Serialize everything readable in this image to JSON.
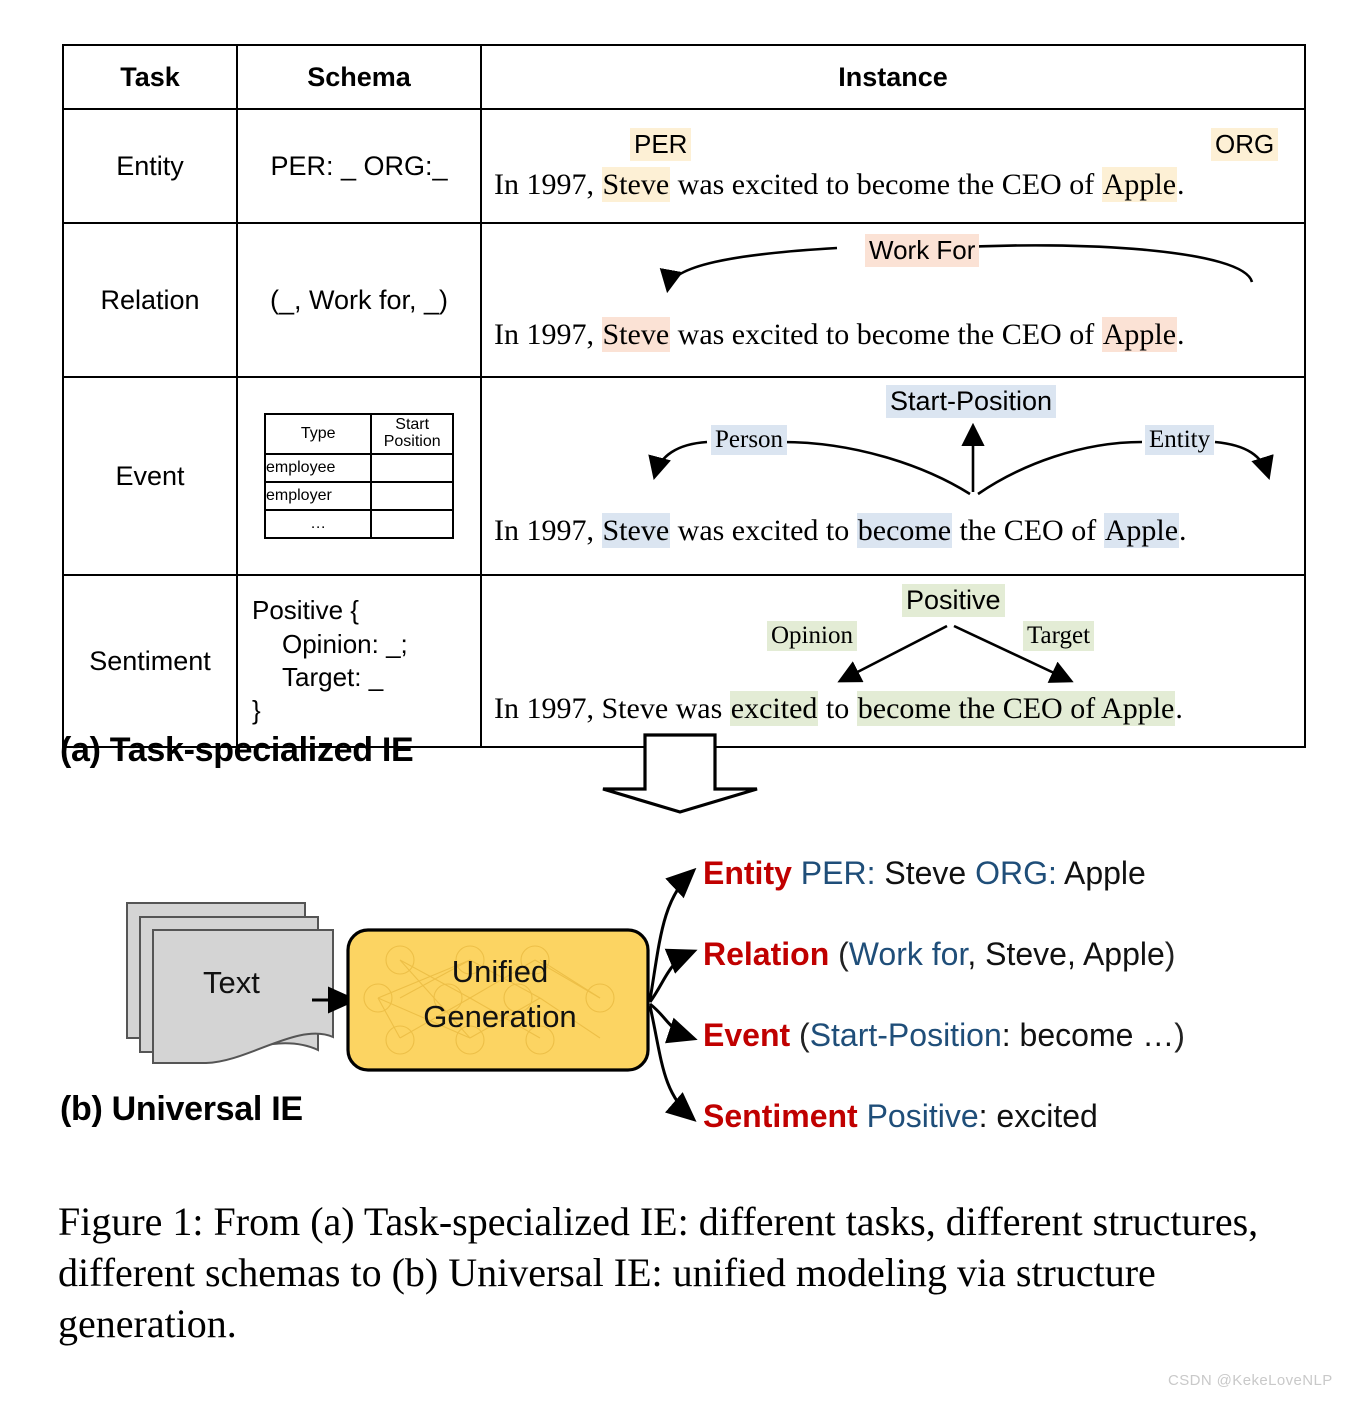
{
  "table": {
    "headers": [
      "Task",
      "Schema",
      "Instance"
    ],
    "rows": [
      {
        "task": "Entity",
        "schema": "PER: _ ORG:_",
        "sentence_prefix": "In 1997, ",
        "parts": [
          "In 1997, ",
          "Steve",
          " was excited to become the CEO of ",
          "Apple",
          "."
        ],
        "labels": [
          "PER",
          "ORG"
        ],
        "highlight_color": "#fdf0d5"
      },
      {
        "task": "Relation",
        "schema": "(_, Work for, _)",
        "parts": [
          "In 1997, ",
          "Steve",
          " was excited to become the CEO of ",
          "Apple",
          "."
        ],
        "labels": [
          "Work For"
        ],
        "highlight_color": "#fbe2d5"
      },
      {
        "task": "Event",
        "schema_table": {
          "headers": [
            "Type",
            "Start Position"
          ],
          "header_line1": "Start",
          "header_line2": "Position",
          "rows": [
            "employee",
            "employer",
            "…"
          ]
        },
        "parts": [
          "In 1997, ",
          "Steve",
          " was excited to ",
          "become",
          " the CEO of ",
          "Apple",
          "."
        ],
        "labels": [
          "Start-Position",
          "Person",
          "Entity"
        ],
        "highlight_color": "#dbe5f1"
      },
      {
        "task": "Sentiment",
        "schema_lines": [
          "Positive {",
          "Opinion: _;",
          "Target: _",
          "}"
        ],
        "parts": [
          "In 1997, Steve was ",
          "excited",
          " to ",
          "become the CEO of Apple",
          "."
        ],
        "labels": [
          "Positive",
          "Opinion",
          "Target"
        ],
        "highlight_color": "#e3ecd5"
      }
    ]
  },
  "part_a_caption": "(a) Task-specialized IE",
  "part_b_caption": "(b) Universal IE",
  "pipeline": {
    "input_label": "Text",
    "model_line1": "Unified",
    "model_line2": "Generation",
    "model_color": "#fcd462",
    "doc_color": "#d4d4d4",
    "arrow_label": "down-arrow"
  },
  "outputs": [
    {
      "task": "Entity",
      "segments": [
        {
          "t": " PER:",
          "c": "key"
        },
        {
          "t": " Steve",
          "c": "val"
        },
        {
          "t": " ORG:",
          "c": "key"
        },
        {
          "t": " Apple",
          "c": "val"
        }
      ]
    },
    {
      "task": "Relation",
      "segments": [
        {
          "t": " (",
          "c": "paren"
        },
        {
          "t": "Work for",
          "c": "key"
        },
        {
          "t": ", Steve, Apple",
          "c": "val"
        },
        {
          "t": ")",
          "c": "paren"
        }
      ]
    },
    {
      "task": "Event",
      "segments": [
        {
          "t": "  (",
          "c": "paren"
        },
        {
          "t": "Start-Position",
          "c": "key"
        },
        {
          "t": ": become …",
          "c": "val"
        },
        {
          "t": ")",
          "c": "paren"
        }
      ]
    },
    {
      "task": "Sentiment",
      "segments": [
        {
          "t": "  Positive",
          "c": "key"
        },
        {
          "t": ": excited",
          "c": "val"
        }
      ]
    }
  ],
  "output_colors": {
    "task": "#c00000",
    "key": "#1f4e79",
    "value": "#111111"
  },
  "figure_caption": "Figure 1: From (a) Task-specialized IE: different tasks, different structures, different schemas to (b) Universal IE: unified modeling via structure generation.",
  "watermark": "CSDN @KekeLoveNLP"
}
